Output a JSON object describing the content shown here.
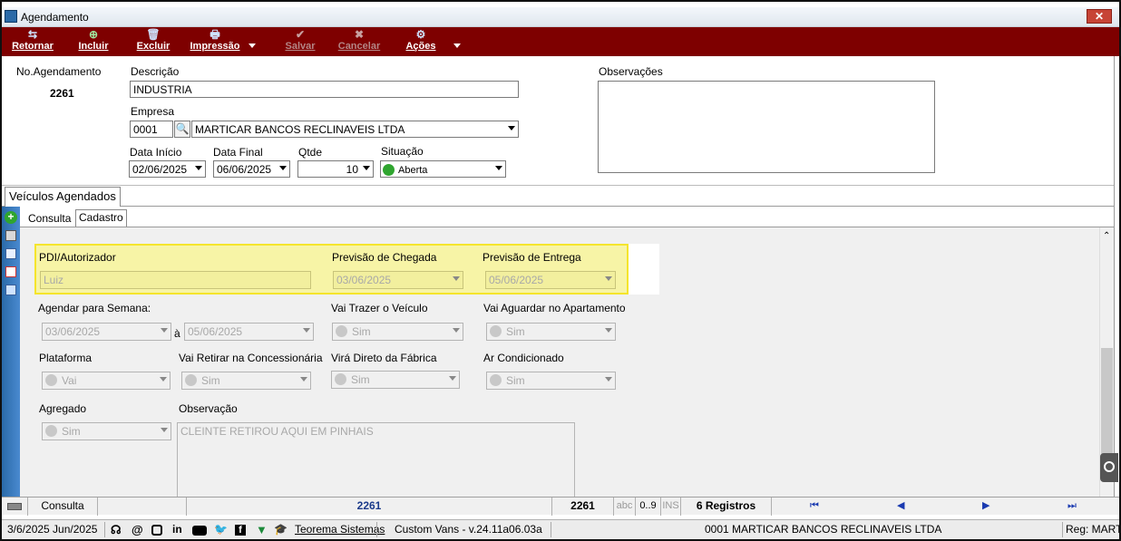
{
  "window": {
    "title": "Agendamento",
    "close": "✕"
  },
  "toolbar": {
    "retornar": "Retornar",
    "incluir": "Incluir",
    "excluir": "Excluir",
    "impressao": "Impressão",
    "salvar": "Salvar",
    "cancelar": "Cancelar",
    "acoes": "Ações",
    "icons": {
      "retornar": "⇆",
      "incluir": "⊕",
      "excluir": "🗑",
      "impressao": "🖶",
      "salvar": "✔",
      "cancelar": "✖",
      "acoes": "⚙"
    }
  },
  "header": {
    "no_label": "No.Agendamento",
    "no_value": "2261",
    "descricao_label": "Descrição",
    "descricao_value": "INDUSTRIA",
    "empresa_label": "Empresa",
    "empresa_code": "0001",
    "empresa_name": "MARTICAR BANCOS RECLINAVEIS LTDA",
    "data_inicio_label": "Data Início",
    "data_inicio_value": "02/06/2025",
    "data_final_label": "Data Final",
    "data_final_value": "06/06/2025",
    "qtde_label": "Qtde",
    "qtde_value": "10",
    "situacao_label": "Situação",
    "situacao_value": "Aberta",
    "observacoes_label": "Observações"
  },
  "tabs": {
    "main": "Veículos Agendados",
    "consulta": "Consulta",
    "cadastro": "Cadastro"
  },
  "form": {
    "pdi_label": "PDI/Autorizador",
    "pdi_value": "Luiz",
    "prev_chegada_label": "Previsão de Chegada",
    "prev_chegada_value": "03/06/2025",
    "prev_entrega_label": "Previsão de Entrega",
    "prev_entrega_value": "05/06/2025",
    "agendar_label": "Agendar para Semana:",
    "agendar_from": "03/06/2025",
    "agendar_sep": "à",
    "agendar_to": "05/06/2025",
    "trazer_label": "Vai Trazer o Veículo",
    "trazer_value": "Sim",
    "aguardar_label": "Vai Aguardar no Apartamento",
    "aguardar_value": "Sim",
    "plataforma_label": "Plataforma",
    "plataforma_value": "Vai",
    "retirar_label": "Vai Retirar na Concessionária",
    "retirar_value": "Sim",
    "fabrica_label": "Virá Direto da Fábrica",
    "fabrica_value": "Sim",
    "ar_label": "Ar Condicionado",
    "ar_value": "Sim",
    "agregado_label": "Agregado",
    "agregado_value": "Sim",
    "obs_label": "Observação",
    "obs_value": "CLEINTE RETIROU AQUI EM PINHAIS"
  },
  "statusbar": {
    "mode": "Consulta",
    "record": "2261",
    "record2": "2261",
    "abc": "abc",
    "digits": "0..9",
    "ins": "INS",
    "count": "6 Registros",
    "nav_first": "⏮",
    "nav_prev": "◀",
    "nav_next": "▶",
    "nav_last": "⏭"
  },
  "bottombar": {
    "datetime": "3/6/2025 Jun/2025",
    "company_link": "Teorema Sistemas",
    "version": "Custom Vans - v.24.11a06.03a",
    "empresa": "0001 MARTICAR BANCOS RECLINAVEIS LTDA",
    "reg": "Reg: MARTI"
  },
  "colors": {
    "toolbar": "#7e0000",
    "highlight": "#f5e52c",
    "highlight_fill": "#f7f4a6",
    "status_green": "#2fa52f"
  }
}
